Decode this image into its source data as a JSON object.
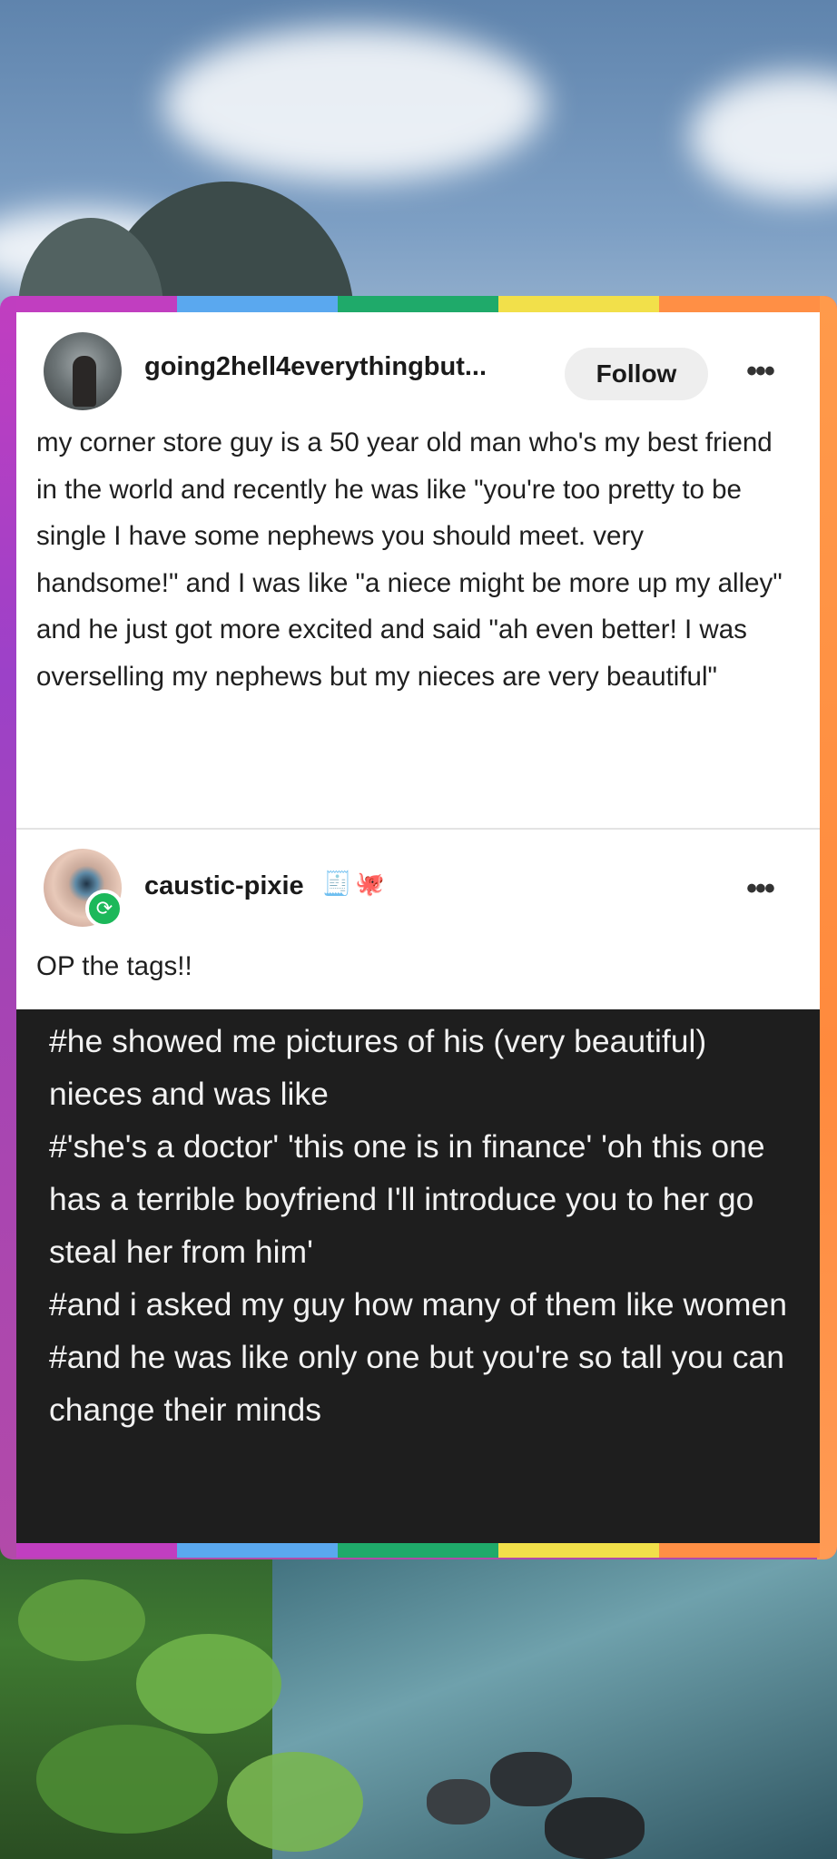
{
  "post": {
    "username": "going2hell4everythingbut...",
    "follow_label": "Follow",
    "more_icon": "more-horizontal-icon",
    "body": "my corner store guy is a 50 year old man who's my best friend in the world and recently he was like \"you're too pretty to be single I have some nephews you should meet. very handsome!\" and I was like \"a niece might be more up my alley\" and he just got more excited and said \"ah even better! I was overselling my nephews but my nieces are very beautiful\""
  },
  "reblog": {
    "username": "caustic-pixie",
    "badges": [
      "🧾",
      "🐙"
    ],
    "text": "OP the tags!!",
    "tags": [
      "#he showed me pictures of his (very beautiful) nieces and was like",
      "#'she's a doctor' 'this one is in finance' 'oh this one has a terrible boyfriend I'll introduce you to her go steal her from him'",
      "#and i asked my guy how many of them like women",
      "#and he was like only one but you're so tall you can change their minds"
    ]
  },
  "colors": {
    "rainbow": [
      "#c13ec0",
      "#5aa8ef",
      "#1faa6a",
      "#f2e04a",
      "#ff8f45"
    ],
    "follow_bg": "#eeeeee",
    "reblog_badge": "#1cb85a",
    "tags_bg": "#1e1e1e"
  }
}
